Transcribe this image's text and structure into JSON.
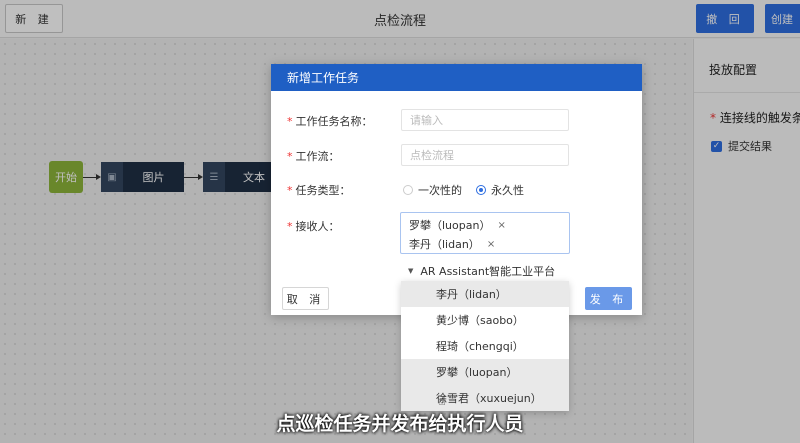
{
  "toolbar": {
    "new_label": "新 建",
    "title": "点检流程",
    "withdraw_label": "撤 回",
    "create_label": "创建"
  },
  "canvas": {
    "start_label": "开始",
    "nodes": [
      {
        "label": "图片",
        "icon": "image-icon"
      },
      {
        "label": "文本",
        "icon": "text-icon"
      }
    ]
  },
  "right_panel": {
    "title": "投放配置",
    "field_label": "连接线的触发条件",
    "checkbox_label": "提交结果"
  },
  "modal": {
    "title": "新增工作任务",
    "task_name_label": "工作任务名称：",
    "task_name_placeholder": "请输入",
    "workflow_label": "工作流：",
    "workflow_value": "点检流程",
    "task_type_label": "任务类型：",
    "type_options": [
      {
        "label": "一次性的",
        "selected": false
      },
      {
        "label": "永久性",
        "selected": true
      }
    ],
    "receiver_label": "接收人：",
    "receivers": [
      "罗攀（luopan）",
      "李丹（lidan）"
    ],
    "remove_symbol": "×",
    "tree_root": "AR Assistant智能工业平台",
    "cancel_label": "取 消",
    "publish_label": "发 布"
  },
  "dropdown": {
    "items": [
      {
        "label": "李丹（lidan）",
        "highlighted": true
      },
      {
        "label": "黄少博（saobo）",
        "highlighted": false
      },
      {
        "label": "程琦（chengqi）",
        "highlighted": false
      },
      {
        "label": "罗攀（luopan）",
        "highlighted": true
      },
      {
        "label": "徐雪君（xuxuejun）",
        "highlighted": true
      }
    ]
  },
  "caption": "点巡检任务并发布给执行人员",
  "colors": {
    "primary": "#2e6ee0",
    "modal_header": "#1f5fc4",
    "start_node": "#8db43a",
    "flow_node": "#1f2f45",
    "required_star": "#e33333"
  }
}
